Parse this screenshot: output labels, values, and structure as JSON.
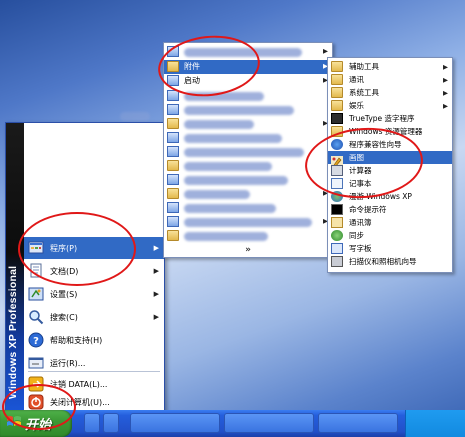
{
  "os_edition": "Windows XP Professional",
  "start_menu": {
    "items": [
      {
        "label": "程序(P)",
        "has_submenu": true,
        "selected": true,
        "icon": "programs-icon"
      },
      {
        "label": "文档(D)",
        "has_submenu": true,
        "icon": "documents-icon"
      },
      {
        "label": "设置(S)",
        "has_submenu": true,
        "icon": "settings-icon"
      },
      {
        "label": "搜索(C)",
        "has_submenu": true,
        "icon": "search-icon"
      },
      {
        "label": "帮助和支持(H)",
        "has_submenu": false,
        "icon": "help-icon"
      },
      {
        "label": "运行(R)...",
        "has_submenu": false,
        "icon": "run-icon"
      },
      {
        "label": "注销 DATA(L)...",
        "has_submenu": false,
        "icon": "logoff-icon"
      },
      {
        "label": "关闭计算机(U)...",
        "has_submenu": false,
        "icon": "shutdown-icon"
      }
    ]
  },
  "programs_menu": {
    "accessories_label": "附件",
    "startup_label": "启动",
    "more_label": "»"
  },
  "accessories_menu": {
    "items": [
      {
        "label": "辅助工具",
        "has_submenu": true,
        "icon": "folder-icon"
      },
      {
        "label": "通讯",
        "has_submenu": true,
        "icon": "folder-icon"
      },
      {
        "label": "系统工具",
        "has_submenu": true,
        "icon": "folder-icon"
      },
      {
        "label": "娱乐",
        "has_submenu": true,
        "icon": "folder-icon"
      },
      {
        "label": "TrueType 造字程序",
        "icon": "font-editor-icon"
      },
      {
        "label": "Windows 资源管理器",
        "icon": "explorer-icon"
      },
      {
        "label": "程序兼容性向导",
        "icon": "compatibility-icon"
      },
      {
        "label": "画图",
        "selected": true,
        "icon": "paint-icon"
      },
      {
        "label": "计算器",
        "icon": "calculator-icon"
      },
      {
        "label": "记事本",
        "icon": "notepad-icon"
      },
      {
        "label": "漫游 Windows XP",
        "icon": "tour-icon"
      },
      {
        "label": "命令提示符",
        "icon": "cmd-icon"
      },
      {
        "label": "通讯簿",
        "icon": "addressbook-icon"
      },
      {
        "label": "同步",
        "icon": "sync-icon"
      },
      {
        "label": "写字板",
        "icon": "wordpad-icon"
      },
      {
        "label": "扫描仪和照相机向导",
        "icon": "scanner-icon"
      }
    ]
  },
  "taskbar": {
    "start_label": "开始"
  },
  "colors": {
    "highlight": "#316ac5",
    "annotation": "#e01818",
    "start_green": "#3c9a35"
  }
}
